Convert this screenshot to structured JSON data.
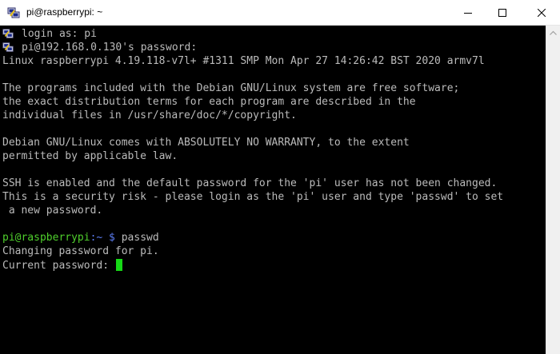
{
  "window": {
    "title": "pi@raspberrypi: ~",
    "app_icon": "putty-icon",
    "controls": {
      "minimize": "minimize-icon",
      "maximize": "maximize-icon",
      "close": "close-icon"
    }
  },
  "terminal": {
    "lines": [
      "login as: pi",
      "pi@192.168.0.130's password:",
      "Linux raspberrypi 4.19.118-v7l+ #1311 SMP Mon Apr 27 14:26:42 BST 2020 armv7l",
      "",
      "The programs included with the Debian GNU/Linux system are free software;",
      "the exact distribution terms for each program are described in the",
      "individual files in /usr/share/doc/*/copyright.",
      "",
      "Debian GNU/Linux comes with ABSOLUTELY NO WARRANTY, to the extent",
      "permitted by applicable law.",
      "",
      "SSH is enabled and the default password for the 'pi' user has not been changed.",
      "This is a security risk - please login as the 'pi' user and type 'passwd' to set",
      " a new password.",
      ""
    ],
    "prompt": {
      "user_host": "pi@raspberrypi",
      "path": ":~ $",
      "command": "passwd"
    },
    "output": [
      "Changing password for pi.",
      "Current password: "
    ]
  },
  "colors": {
    "terminal_bg": "#000000",
    "terminal_fg": "#bbbbbb",
    "prompt_user": "#4fcf2c",
    "prompt_path": "#5b7cf2",
    "cursor": "#16d916"
  }
}
